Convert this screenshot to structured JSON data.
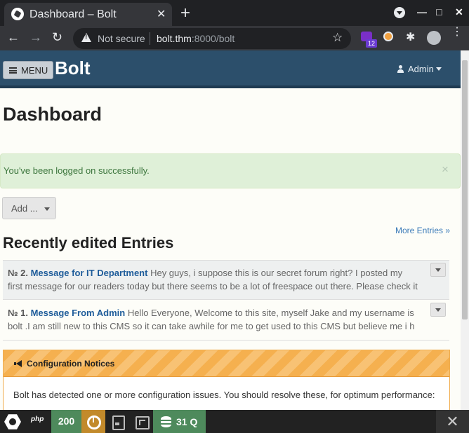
{
  "browser": {
    "tab_title": "Dashboard – Bolt",
    "tab_close": "✕",
    "new_tab": "+",
    "minimize": "—",
    "maximize": "□",
    "close": "✕",
    "back": "←",
    "forward": "→",
    "reload": "↻",
    "security_label": "Not secure",
    "url_host": "bolt.thm",
    "url_rest": ":8000/bolt",
    "bookmark": "☆",
    "extension_badge": "12",
    "extensions": "✱",
    "menu": "⋮"
  },
  "navbar": {
    "menu_label": "MENU",
    "brand": "Bolt",
    "user_label": "Admin"
  },
  "page": {
    "title": "Dashboard",
    "alert_text": "You've been logged on successfully.",
    "alert_close": "×",
    "add_label": "Add ...",
    "more_entries": "More Entries »",
    "section_title": "Recently edited Entries"
  },
  "entries": [
    {
      "number": "№ 2.",
      "title": "Message for IT Department",
      "excerpt": "Hey guys, i suppose this is our secret forum right? I posted my first message for our readers today but there seems to be a lot of freespace out there. Please check it ou"
    },
    {
      "number": "№ 1.",
      "title": "Message From Admin",
      "excerpt": "Hello Everyone, Welcome to this site, myself Jake and my username is bolt .I am still new to this CMS so it can take awhile for me to get used to this CMS but believe me i h"
    }
  ],
  "notice": {
    "title": "Configuration Notices",
    "body": "Bolt has detected one or more configuration issues. You should resolve these, for optimum performance:"
  },
  "debugbar": {
    "php": "php",
    "status": "200",
    "queries": "31 Q",
    "close": "✕"
  },
  "colors": {
    "navbar": "#2c4f6b",
    "alert_bg": "#dff0d8",
    "alert_text": "#3c763d",
    "link": "#1e5c9a",
    "notice": "#f5b04f",
    "debug_green": "#4e8a5c",
    "debug_orange": "#c28a2b"
  }
}
